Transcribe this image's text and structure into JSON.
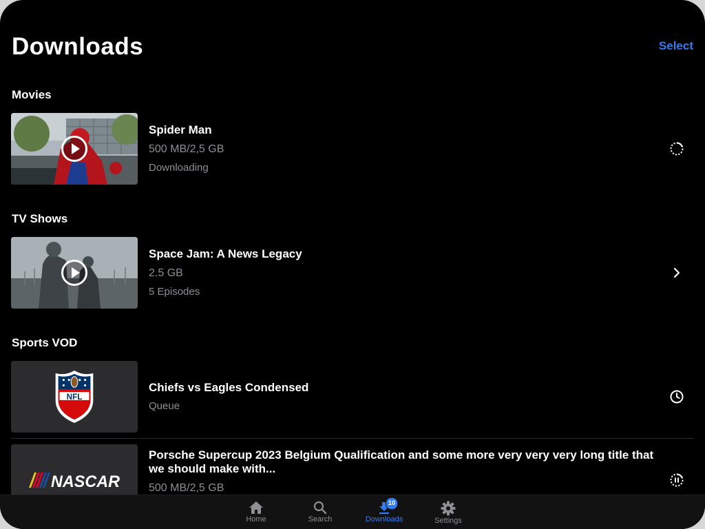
{
  "header": {
    "title": "Downloads",
    "select_label": "Select"
  },
  "sections": {
    "movies": {
      "label": "Movies",
      "items": [
        {
          "title": "Spider Man",
          "size": "500 MB/2,5 GB",
          "status": "Downloading",
          "action_icon": "progress-spinner-icon",
          "progress": 0.2
        }
      ]
    },
    "tv": {
      "label": "TV Shows",
      "items": [
        {
          "title": "Space Jam: A News Legacy",
          "size": "2.5 GB",
          "status": "5 Episodes",
          "action_icon": "chevron-right-icon"
        }
      ]
    },
    "sports": {
      "label": "Sports VOD",
      "items": [
        {
          "title": "Chiefs vs Eagles Condensed",
          "status": "Queue",
          "logo": "NFL",
          "action_icon": "clock-icon"
        },
        {
          "title": "Porsche Supercup 2023 Belgium Qualification and some more very very very long title that we should make with...",
          "size": "500 MB/2,5 GB",
          "logo": "NASCAR",
          "action_icon": "pause-progress-icon",
          "progress": 0.2
        }
      ]
    }
  },
  "tabbar": {
    "tabs": [
      {
        "label": "Home",
        "icon": "home-icon"
      },
      {
        "label": "Search",
        "icon": "search-icon"
      },
      {
        "label": "Downloads",
        "icon": "download-icon",
        "badge": "10",
        "active": true
      },
      {
        "label": "Settings",
        "icon": "gear-icon"
      }
    ]
  },
  "colors": {
    "accent": "#2f7cf6",
    "background": "#000000",
    "secondary_text": "#8e8e93",
    "tabbar": "#121212"
  }
}
